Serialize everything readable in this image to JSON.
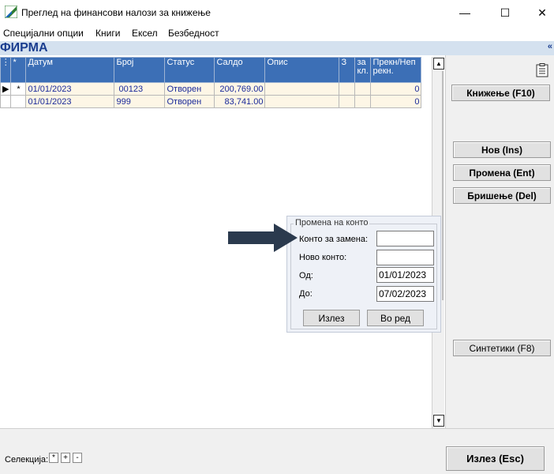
{
  "window": {
    "title": "Преглед на финансови налози за книжење",
    "minimize": "—",
    "maximize": "☐",
    "close": "✕"
  },
  "menu": [
    "Специјални опции",
    "Книги",
    "Ексел",
    "Безбедност"
  ],
  "section": {
    "title": "ФИРМА",
    "collapse": "«"
  },
  "grid": {
    "columns": [
      "*",
      "Датум",
      "Број",
      "Статус",
      "Салдо",
      "Опис",
      "З",
      "за кл.",
      "Прекн/Неп рекн."
    ],
    "rows": [
      {
        "indicator": "▶",
        "star": "*",
        "datum": "01/01/2023",
        "broj": "00123",
        "status": "Отворен",
        "saldo": "200,769.00",
        "opis": "",
        "z": "",
        "zakl": "",
        "prekn": "0"
      },
      {
        "indicator": "",
        "star": "",
        "datum": "01/01/2023",
        "broj": "999",
        "status": "Отворен",
        "saldo": "83,741.00",
        "opis": "",
        "z": "",
        "zakl": "",
        "prekn": "0"
      }
    ]
  },
  "right_panel": {
    "clipboard_icon": "clipboard-icon",
    "post_button": "Книжење (F10)",
    "new_button": "Нов (Ins)",
    "edit_button": "Промена (Ent)",
    "delete_button": "Бришење (Del)",
    "synthetic_button": "Синтетики (F8)"
  },
  "dialog": {
    "legend": "Промена на конто",
    "konto_label": "Конто за замена:",
    "konto_value": "",
    "novo_label": "Ново конто:",
    "novo_value": "",
    "od_label": "Од:",
    "od_value": "01/01/2023",
    "do_label": "До:",
    "do_value": "07/02/2023",
    "exit_button": "Излез",
    "ok_button": "Во ред"
  },
  "bottom": {
    "selection_label": "Селекција:",
    "sel_all": "*",
    "sel_plus": "+",
    "sel_minus": "-",
    "exit_button": "Излез (Esc)"
  },
  "colors": {
    "grid_header": "#3c6fb6",
    "row_bg": "#fdf6e6",
    "section_bar": "#d4e1ef",
    "arrow": "#2b3a4e"
  }
}
